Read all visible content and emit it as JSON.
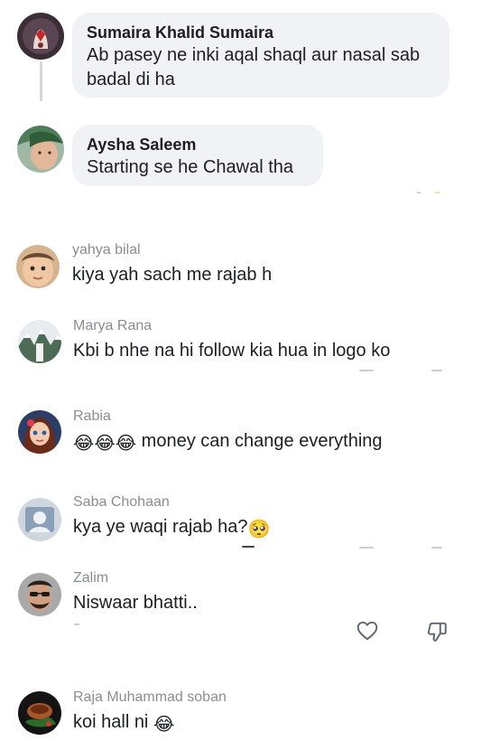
{
  "comments": [
    {
      "author": "Sumaira Khalid Sumaira",
      "text_line1": "Ab pasey ne inki aqal shaql aur nasal sab",
      "text_line2": "badal di ha",
      "avatar": "avatar-hands-henna"
    },
    {
      "author": "Aysha Saleem",
      "text": "Starting se he  Chawal tha",
      "avatar": "avatar-woman-green"
    },
    {
      "author": "yahya bilal",
      "text": "kiya yah sach me rajab h",
      "avatar": "avatar-baby"
    },
    {
      "author": "Marya Rana",
      "text": "Kbi b nhe na hi follow kia hua in logo ko",
      "avatar": "avatar-snowy-trees"
    },
    {
      "author": "Rabia",
      "text": " money can change everything",
      "emoji_prefix": "😂😂😂",
      "avatar": "avatar-cartoon-girl"
    },
    {
      "author": "Saba Chohaan",
      "text": "kya ye waqi rajab ha?",
      "emoji_suffix": "🥺",
      "avatar": "avatar-photo-gray"
    },
    {
      "author": "Zalim",
      "text": "Niswaar bhatti..",
      "avatar": "avatar-man-sunglasses"
    },
    {
      "author": "Raja Muhammad soban",
      "text": "koi hall ni ",
      "emoji_suffix": "😂",
      "avatar": "avatar-dark-food"
    }
  ],
  "actions": {
    "like_icon": "heart-outline-icon",
    "dislike_icon": "thumbs-down-outline-icon"
  },
  "colors": {
    "bubble_bg": "#f0f2f5",
    "name_gray": "#8a8d91",
    "text": "#1c1e21"
  }
}
